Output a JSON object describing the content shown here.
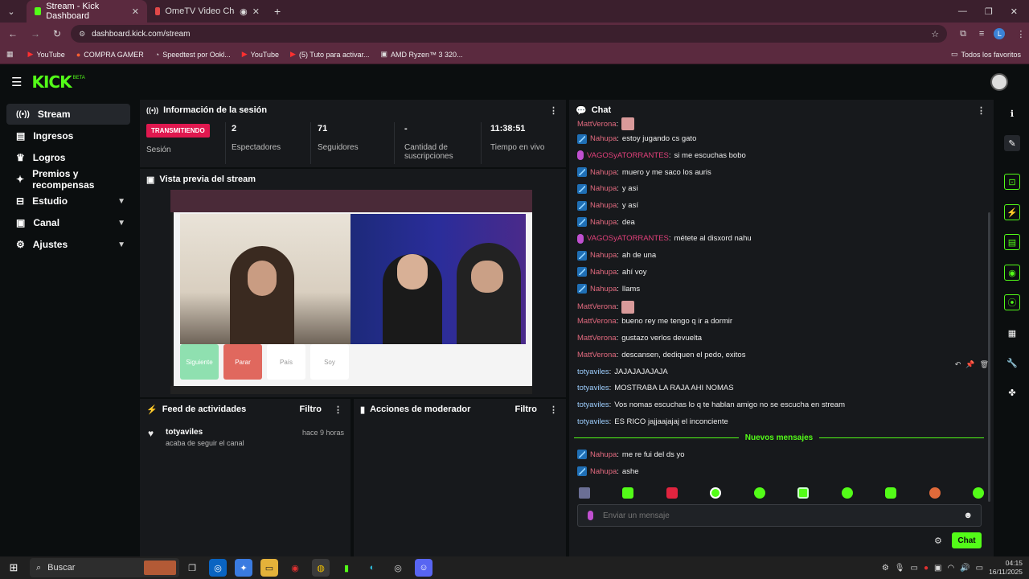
{
  "browser": {
    "tabs": [
      {
        "label": "Stream - Kick Dashboard",
        "active": true
      },
      {
        "label": "OmeTV Video Chat — Ome",
        "active": false
      }
    ],
    "url": "dashboard.kick.com/stream",
    "bookmarks": [
      "YouTube",
      "COMPRA GAMER",
      "Speedtest por Ookl...",
      "YouTube",
      "(5) Tuto para activar...",
      "AMD Ryzen™ 3 320..."
    ],
    "bookmarks_all": "Todos los favoritos",
    "profile_initial": "L"
  },
  "kick": {
    "logo": "KICK",
    "logo_sup": "BETA",
    "brand_color": "#53fc18"
  },
  "sidebar": {
    "items": [
      {
        "label": "Stream",
        "icon": "broadcast-icon"
      },
      {
        "label": "Ingresos",
        "icon": "revenue-icon"
      },
      {
        "label": "Logros",
        "icon": "trophy-icon"
      },
      {
        "label": "Premios y recompensas",
        "icon": "gift-icon"
      },
      {
        "label": "Estudio",
        "icon": "studio-icon"
      },
      {
        "label": "Canal",
        "icon": "channel-icon"
      },
      {
        "label": "Ajustes",
        "icon": "gear-icon"
      }
    ]
  },
  "session": {
    "title": "Información de la sesión",
    "status_badge": "TRANSMITIENDO",
    "status_label": "Sesión",
    "viewers_value": "2",
    "viewers_label": "Espectadores",
    "followers_value": "71",
    "followers_label": "Seguidores",
    "subs_value": "-",
    "subs_label": "Cantidad de suscripciones",
    "time_value": "11:38:51",
    "time_label": "Tiempo en vivo"
  },
  "preview": {
    "title": "Vista previa del stream",
    "buttons": [
      "Siguiente",
      "Parar",
      "País",
      "Soy"
    ]
  },
  "activity": {
    "title": "Feed de actividades",
    "filter": "Filtro",
    "items": [
      {
        "user": "totyaviles",
        "text": "acaba de seguir el canal",
        "time": "hace 9 horas"
      }
    ]
  },
  "moderator": {
    "title": "Acciones de moderador",
    "filter": "Filtro"
  },
  "chat": {
    "title": "Chat",
    "messages": [
      {
        "user": "MattVerona",
        "text": "",
        "badge": "none",
        "emote": true
      },
      {
        "user": "Nahupa",
        "text": "estoy jugando cs gato",
        "badge": "mod"
      },
      {
        "user": "VAGOSyATORRANTES",
        "text": "si me escuchas bobo",
        "badge": "mic"
      },
      {
        "user": "Nahupa",
        "text": "muero y me saco los auris",
        "badge": "mod"
      },
      {
        "user": "Nahupa",
        "text": "y asi",
        "badge": "mod"
      },
      {
        "user": "Nahupa",
        "text": "y así",
        "badge": "mod"
      },
      {
        "user": "Nahupa",
        "text": "dea",
        "badge": "mod"
      },
      {
        "user": "VAGOSyATORRANTES",
        "text": "métete al disxord nahu",
        "badge": "mic"
      },
      {
        "user": "Nahupa",
        "text": "ah de una",
        "badge": "mod"
      },
      {
        "user": "Nahupa",
        "text": "ahí voy",
        "badge": "mod"
      },
      {
        "user": "Nahupa",
        "text": "llams",
        "badge": "mod"
      },
      {
        "user": "MattVerona",
        "text": "",
        "badge": "none",
        "emote": true
      },
      {
        "user": "MattVerona",
        "text": "bueno rey me tengo q ir a dormir",
        "badge": "none"
      },
      {
        "user": "MattVerona",
        "text": "gustazo verlos devuelta",
        "badge": "none"
      },
      {
        "user": "MattVerona",
        "text": "descansen, dediquen el pedo, exitos",
        "badge": "none"
      },
      {
        "user": "totyaviles",
        "text": "JAJAJAJAJAJA",
        "badge": "none"
      },
      {
        "user": "totyaviles",
        "text": "MOSTRABA LA RAJA AHI NOMAS",
        "badge": "none"
      },
      {
        "user": "totyaviles",
        "text": "Vos nomas escuchas lo q te hablan amigo no se escucha en stream",
        "badge": "none"
      },
      {
        "user": "totyaviles",
        "text": "ES RICO jajjaajajaj el inconciente",
        "badge": "none"
      }
    ],
    "new_messages": "Nuevos mensajes",
    "new": [
      {
        "user": "Nahupa",
        "text": "me re fui del ds yo",
        "badge": "mod"
      },
      {
        "user": "Nahupa",
        "text": "ashe",
        "badge": "mod"
      }
    ],
    "input_placeholder": "Enviar un mensaje",
    "send_label": "Chat"
  },
  "taskbar": {
    "search": "Buscar",
    "time": "04:15",
    "date": "16/11/2025"
  }
}
